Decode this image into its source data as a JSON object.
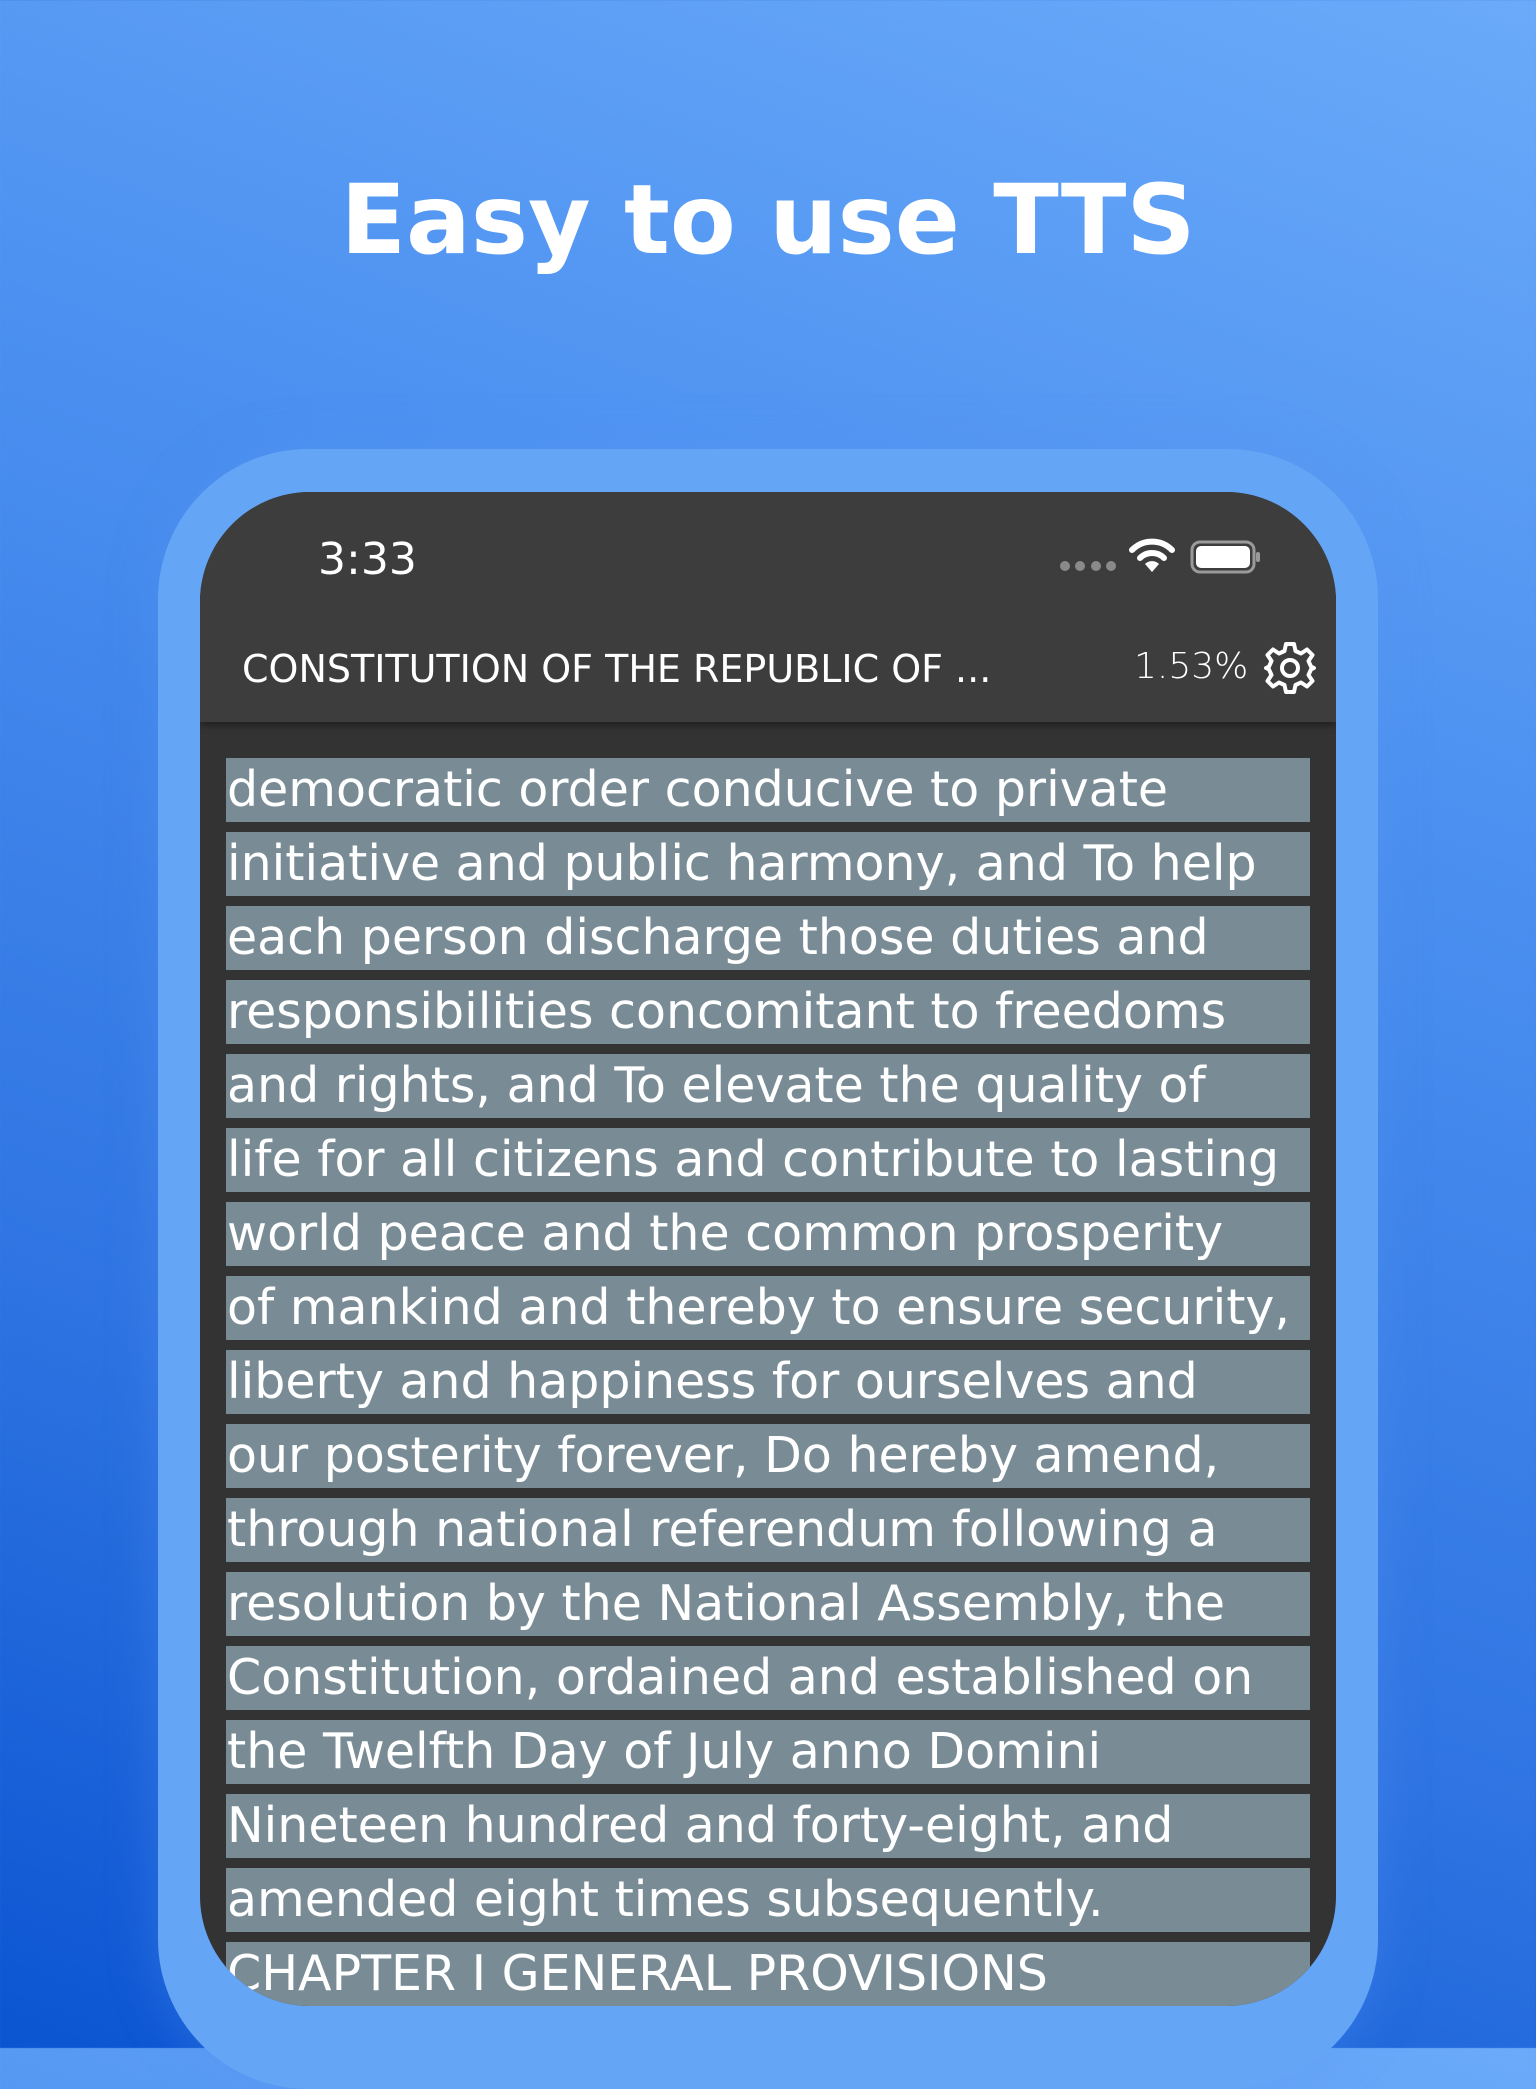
{
  "headline": "Easy to use TTS",
  "status_bar": {
    "time": "3:33"
  },
  "reader": {
    "title": "CONSTITUTION OF THE REPUBLIC OF ...",
    "progress": "1.53%",
    "lines": [
      "democratic order conducive to private",
      "initiative and public harmony, and To help",
      "each person discharge those duties and",
      "responsibilities concomitant to freedoms",
      "and rights, and To elevate the quality of",
      "life for all citizens and contribute to lasting",
      "world peace and the common prosperity",
      "of mankind and thereby to ensure security,",
      "liberty and happiness for ourselves and",
      "our posterity forever, Do hereby amend,",
      "through national referendum following a",
      "resolution by the National Assembly, the",
      "Constitution, ordained and established on",
      "the Twelfth Day of July anno Domini",
      "Nineteen hundred and forty-eight, and",
      "amended eight times subsequently.",
      "CHAPTER I GENERAL PROVISIONS"
    ]
  },
  "icons": {
    "signal": "signal-dots-icon",
    "wifi": "wifi-icon",
    "battery": "battery-icon",
    "settings": "gear-icon"
  },
  "colors": {
    "background_top": "#6aaaf9",
    "background_bottom": "#0b55d2",
    "phone_frame": "#64a5f5",
    "screen_background": "#333333",
    "top_bar": "#3d3d3d",
    "highlight": "#798c96",
    "text": "#ffffff"
  }
}
